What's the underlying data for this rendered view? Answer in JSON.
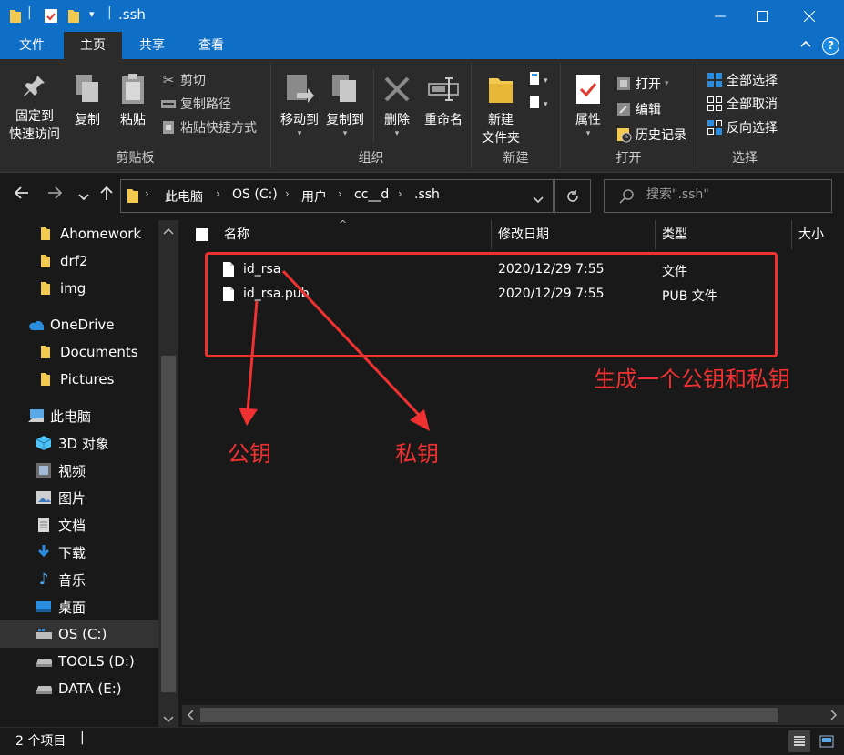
{
  "window": {
    "title": ".ssh",
    "minimize_icon": "minimize-icon",
    "maximize_icon": "maximize-icon",
    "close_icon": "close-icon"
  },
  "tabs": [
    {
      "label": "文件",
      "active": false
    },
    {
      "label": "主页",
      "active": true
    },
    {
      "label": "共享",
      "active": false
    },
    {
      "label": "查看",
      "active": false
    }
  ],
  "ribbon": {
    "clipboard": {
      "label": "剪贴板",
      "pin_line1": "固定到",
      "pin_line2": "快速访问",
      "copy": "复制",
      "paste": "粘贴",
      "cut": "剪切",
      "copy_path": "复制路径",
      "paste_shortcut": "粘贴快捷方式"
    },
    "organize": {
      "label": "组织",
      "move_to": "移动到",
      "copy_to": "复制到",
      "delete": "删除",
      "rename": "重命名"
    },
    "new": {
      "label": "新建",
      "new_folder_line1": "新建",
      "new_folder_line2": "文件夹"
    },
    "open": {
      "label": "打开",
      "properties": "属性",
      "open": "打开",
      "edit": "编辑",
      "history": "历史记录"
    },
    "select": {
      "label": "选择",
      "select_all": "全部选择",
      "select_none": "全部取消",
      "invert": "反向选择"
    }
  },
  "address": {
    "crumbs": [
      "此电脑",
      "OS (C:)",
      "用户",
      "cc__d",
      ".ssh"
    ],
    "search_placeholder": "搜索\".ssh\""
  },
  "nav": {
    "items": [
      {
        "label": "Ahomework",
        "icon": "folder-icon"
      },
      {
        "label": "drf2",
        "icon": "folder-icon"
      },
      {
        "label": "img",
        "icon": "folder-icon"
      },
      {
        "label": "OneDrive",
        "icon": "cloud-icon"
      },
      {
        "label": "Documents",
        "icon": "folder-icon"
      },
      {
        "label": "Pictures",
        "icon": "folder-icon"
      },
      {
        "label": "此电脑",
        "icon": "computer-icon"
      },
      {
        "label": "3D 对象",
        "icon": "cube-icon"
      },
      {
        "label": "视频",
        "icon": "video-icon"
      },
      {
        "label": "图片",
        "icon": "picture-icon"
      },
      {
        "label": "文档",
        "icon": "document-icon"
      },
      {
        "label": "下载",
        "icon": "download-icon"
      },
      {
        "label": "音乐",
        "icon": "music-icon"
      },
      {
        "label": "桌面",
        "icon": "desktop-icon"
      },
      {
        "label": "OS (C:)",
        "icon": "drive-icon",
        "selected": true
      },
      {
        "label": "TOOLS (D:)",
        "icon": "drive-icon"
      },
      {
        "label": "DATA (E:)",
        "icon": "drive-icon"
      }
    ]
  },
  "columns": {
    "name": "名称",
    "modified": "修改日期",
    "type": "类型",
    "size": "大小"
  },
  "files": [
    {
      "name": "id_rsa",
      "modified": "2020/12/29 7:55",
      "type": "文件"
    },
    {
      "name": "id_rsa.pub",
      "modified": "2020/12/29 7:55",
      "type": "PUB 文件"
    }
  ],
  "annotations": {
    "box_label": "生成一个公钥和私钥",
    "public_key": "公钥",
    "private_key": "私钥",
    "color": "#f03131"
  },
  "status": {
    "item_count": "2 个项目"
  },
  "colors": {
    "accent": "#0f6fc6",
    "background": "#191919",
    "ribbon": "#2b2b2b"
  }
}
